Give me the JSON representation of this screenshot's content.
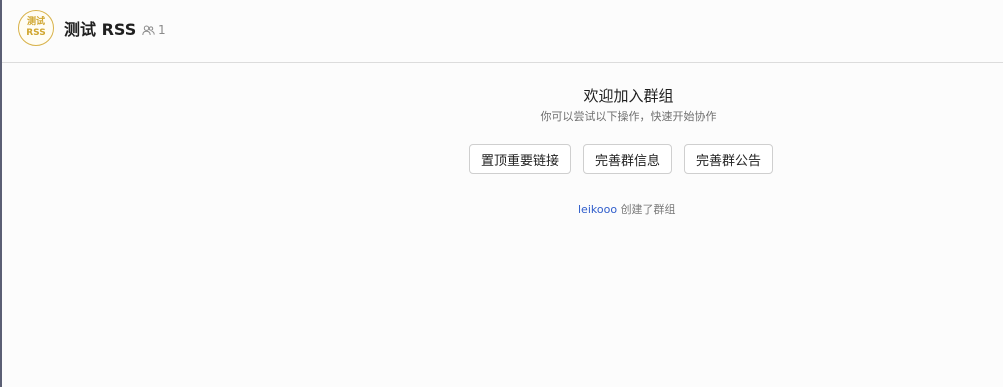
{
  "header": {
    "avatar_line1": "测试",
    "avatar_line2": "RSS",
    "title": "测试 RSS",
    "member_icon": "users-icon",
    "member_count": "1"
  },
  "welcome": {
    "title": "欢迎加入群组",
    "subtitle": "你可以尝试以下操作，快速开始协作"
  },
  "actions": [
    {
      "label": "置顶重要链接"
    },
    {
      "label": "完善群信息"
    },
    {
      "label": "完善群公告"
    }
  ],
  "activity": {
    "creator": "leikooo",
    "text": "创建了群组"
  },
  "colors": {
    "avatar_accent": "#d8b24a",
    "link": "#2f5dcb",
    "left_edge": "#5b5f74"
  }
}
